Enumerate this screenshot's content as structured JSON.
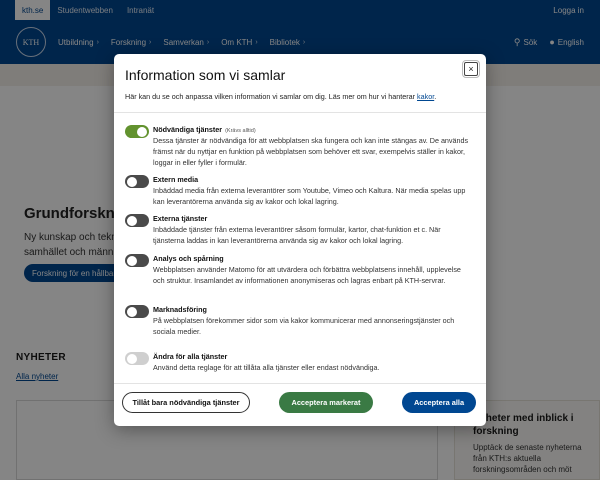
{
  "topbar": {
    "links": [
      "kth.se",
      "Studentwebben",
      "Intranät"
    ],
    "login": "Logga in"
  },
  "header": {
    "logo_text": "KTH",
    "nav": [
      "Utbildning",
      "Forskning",
      "Samverkan",
      "Om KTH",
      "Bibliotek"
    ],
    "search": "Sök",
    "language": "English"
  },
  "page": {
    "hero_title": "Grundforskning",
    "hero_text": "Ny kunskap och tekni samhället och männis",
    "hero_button": "Forskning för en hållbar",
    "news_title": "NYHETER",
    "news_link": "Alla nyheter",
    "aside_title": "Nyheter med inblick i forskning",
    "aside_text": "Upptäck de senaste nyheterna från KTH:s aktuella forskningsområden och möt"
  },
  "modal": {
    "title": "Information som vi samlar",
    "intro": "Här kan du se och anpassa vilken information vi samlar om dig. Läs mer om hur vi hanterar",
    "intro_link": "kakor",
    "intro_end": ".",
    "close_label": "×",
    "settings": [
      {
        "title": "Nödvändiga tjänster",
        "tag": "(Krävs alltid)",
        "desc": "Dessa tjänster är nödvändiga för att webbplatsen ska fungera och kan inte stängas av. De används främst när du nyttjar en funktion på webbplatsen som behöver ett svar, exempelvis ställer in kakor, loggar in eller fyller i formulär.",
        "state": "on"
      },
      {
        "title": "Extern media",
        "desc": "Inbäddad media från externa leverantörer som Youtube, Vimeo och Kaltura. När media spelas upp kan leverantörerna använda sig av kakor och lokal lagring.",
        "state": "off"
      },
      {
        "title": "Externa tjänster",
        "desc": "Inbäddade tjänster från externa leverantörer såsom formulär, kartor, chat-funktion et c. När tjänsterna laddas in kan leverantörerna använda sig av kakor och lokal lagring.",
        "state": "off"
      },
      {
        "title": "Analys och spårning",
        "desc": "Webbplatsen använder Matomo för att utvärdera och förbättra webbplatsens innehåll, upplevelse och struktur. Insamlandet av informationen anonymiseras och lagras enbart på KTH-servrar.",
        "state": "off"
      },
      {
        "title": "Marknadsföring",
        "desc": "På webbplatsen förekommer sidor som via kakor kommunicerar med annonseringstjänster och sociala medier.",
        "state": "off"
      },
      {
        "title": "Ändra för alla tjänster",
        "desc": "Använd detta reglage för att tillåta alla tjänster eller endast nödvändiga.",
        "state": "light"
      }
    ],
    "buttons": {
      "necessary_only": "Tillåt bara nödvändiga tjänster",
      "accept_selected": "Acceptera markerat",
      "accept_all": "Acceptera alla"
    }
  },
  "colors": {
    "brand_blue": "#004791",
    "toggle_on": "#62922e",
    "accept_green": "#3a7a44"
  }
}
